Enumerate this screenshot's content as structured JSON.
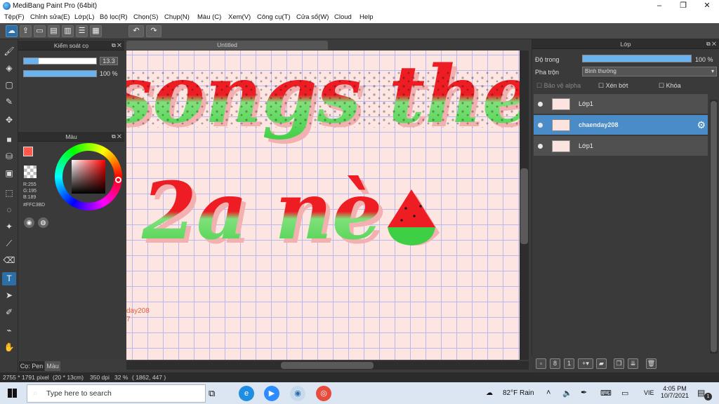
{
  "window": {
    "title": "MediBang Paint Pro (64bit)",
    "minimize": "–",
    "maximize": "❐",
    "close": "✕"
  },
  "menu": [
    "Tệp(F)",
    "Chỉnh sửa(E)",
    "Lớp(L)",
    "Bộ lọc(R)",
    "Chọn(S)",
    "Chụp(N)",
    "Màu (C)",
    "Xem(V)",
    "Công cụ(T)",
    "Cửa sổ(W)",
    "Cloud",
    "Help"
  ],
  "toolbar": {
    "icons": [
      "cloud-icon",
      "share-icon",
      "comment-icon",
      "chat-icon",
      "document-icon",
      "list-icon",
      "grid-icon"
    ],
    "undo": "↶",
    "redo": "↷"
  },
  "brush_panel": {
    "title": "Kiểm soát cọ",
    "size_value": "13.3",
    "size_fill": 0.2,
    "opacity_value": "100 %",
    "opacity_fill": 1.0
  },
  "color_panel": {
    "title": "Màu",
    "r": "R:255",
    "g": "G:195",
    "b": "B:189",
    "hex": "#FFC3BD",
    "fg_color": "#ff5a4e"
  },
  "bottom_tabs": {
    "pen": "Cọ: Pen",
    "color": "Màu"
  },
  "document": {
    "tab_title": "Untitled",
    "line1": "songs theo",
    "line2": "2a nè",
    "watermark1": "day208",
    "watermark2": "7"
  },
  "layers": {
    "title": "Lớp",
    "opacity_label": "Độ trong",
    "opacity_value": "100 %",
    "opacity_fill": 1.0,
    "blend_label": "Pha trộn",
    "blend_value": "Bình thường",
    "protect_alpha": "Bảo vệ alpha",
    "clipping": "Xén bớt",
    "lock": "Khóa",
    "items": [
      {
        "name": "Lớp1",
        "selected": false
      },
      {
        "name": "chaenday208",
        "selected": true
      },
      {
        "name": "Lớp1",
        "selected": false
      }
    ]
  },
  "status": {
    "size": "2755 * 1791 pixel",
    "cm": "(20 * 13cm)",
    "dpi": "350 dpi",
    "zoom": "32 %",
    "coords": "( 1862, 447 )"
  },
  "taskbar": {
    "search_placeholder": "Type here to search",
    "weather": "82°F  Rain",
    "lang": "VIE",
    "time": "4:05 PM",
    "date": "10/7/2021",
    "notif": "1"
  }
}
